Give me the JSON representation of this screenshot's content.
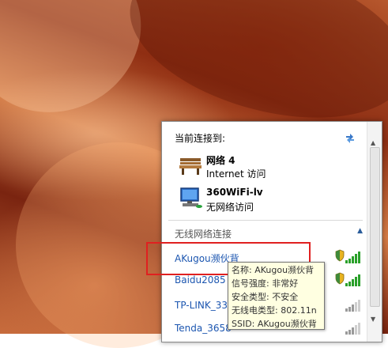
{
  "flyout": {
    "header": "当前连接到:",
    "connections": [
      {
        "name": "网络  4",
        "status": "Internet 访问",
        "icon": "bench-network-icon"
      },
      {
        "name": "360WiFi-lv",
        "status": "无网络访问",
        "icon": "computer-network-icon"
      }
    ],
    "section_label": "无线网络连接",
    "networks": [
      {
        "name": "AKugou濒伙背",
        "secured": true,
        "signal": 5
      },
      {
        "name": "Baidu2085",
        "secured": true,
        "signal": 5
      },
      {
        "name": "TP-LINK_33",
        "secured": false,
        "signal": 3
      },
      {
        "name": "Tenda_3658",
        "secured": false,
        "signal": 3
      }
    ]
  },
  "tooltip": {
    "lines": [
      "名称: AKugou濒伙背",
      "信号强度: 非常好",
      "安全类型: 不安全",
      "无线电类型: 802.11n",
      "SSID: AKugou濒伙背"
    ]
  },
  "colors": {
    "link": "#1c56b0",
    "highlight": "#e02020",
    "tooltip_bg": "#ffffe1"
  }
}
